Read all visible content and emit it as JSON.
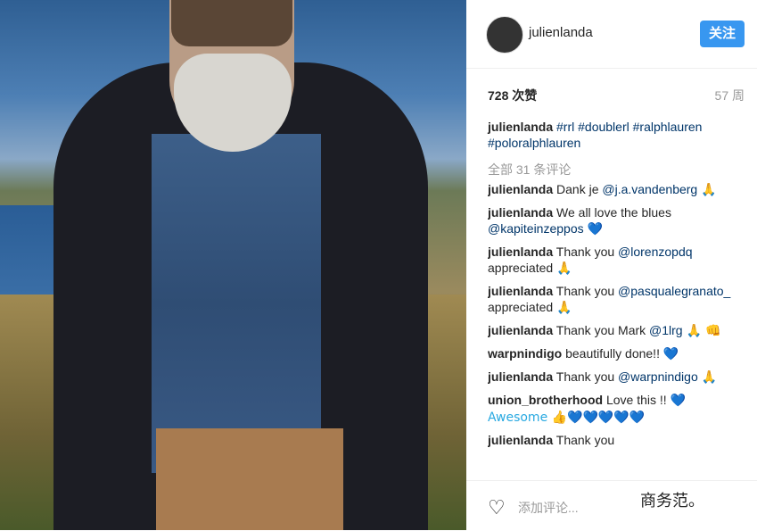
{
  "post": {
    "username": "julienlanda",
    "follow_label": "关注",
    "likes": "728 次赞",
    "age": "57 周",
    "caption": {
      "user": "julienlanda",
      "text": "#rrl #doublerl #ralphlauren #poloralphlauren"
    },
    "all_comments": "全部 31 条评论",
    "comments": [
      {
        "user": "julienlanda",
        "text": "Dank je ",
        "mention": "@j.a.vandenberg",
        "emoji": "🙏"
      },
      {
        "user": "julienlanda",
        "text": "We all love the blues ",
        "mention": "@kapiteinzeppos",
        "emoji": "💙"
      },
      {
        "user": "julienlanda",
        "text": "Thank you ",
        "mention": "@lorenzopdq",
        "after": " appreciated ",
        "emoji": "🙏"
      },
      {
        "user": "julienlanda",
        "text": "Thank you ",
        "mention": "@pasqualegranato_",
        "after": " appreciated ",
        "emoji": "🙏"
      },
      {
        "user": "julienlanda",
        "text": "Thank you Mark ",
        "mention": "@1lrg",
        "emoji": "🙏 👊"
      },
      {
        "user": "warpnindigo",
        "text": "beautifully done!! ",
        "mention": "",
        "emoji": "💙"
      },
      {
        "user": "julienlanda",
        "text": "Thank you ",
        "mention": "@warpnindigo",
        "emoji": "🙏"
      },
      {
        "user": "union_brotherhood",
        "text": "Love this !! ",
        "mention": "",
        "emoji": "💙",
        "after": "Awesome 👍💙💙💙💙💙"
      },
      {
        "user": "julienlanda",
        "text": "Thank you",
        "mention": "",
        "emoji": ""
      }
    ],
    "add_comment_placeholder": "添加评论...",
    "watermark": "商务范。"
  }
}
